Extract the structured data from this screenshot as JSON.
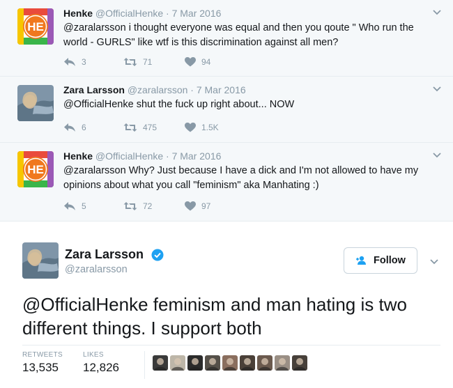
{
  "replies": [
    {
      "name": "Henke",
      "handle": "@OfficialHenke",
      "date": "· 7 Mar 2016",
      "text": "@zaralarsson i thought everyone was equal and then you qoute \" Who run the world - GURLS\" like wtf is this discrimination against all men?",
      "replies_count": "3",
      "retweets": "71",
      "likes": "94",
      "avatar_icon": "he-logo-icon"
    },
    {
      "name": "Zara Larsson",
      "handle": "@zaralarsson",
      "date": "· 7 Mar 2016",
      "text": "@OfficialHenke shut the fuck up right about... NOW",
      "replies_count": "6",
      "retweets": "475",
      "likes": "1.5K",
      "avatar_icon": "profile-photo-icon"
    },
    {
      "name": "Henke",
      "handle": "@OfficialHenke",
      "date": "· 7 Mar 2016",
      "text": "@zaralarsson Why? Just because I have a dick and I'm not allowed to have my opinions about what you call \"feminism\" aka Manhating :)",
      "replies_count": "5",
      "retweets": "72",
      "likes": "97",
      "avatar_icon": "he-logo-icon"
    }
  ],
  "main_tweet": {
    "name": "Zara Larsson",
    "handle": "@zaralarsson",
    "follow_label": "Follow",
    "text": "@OfficialHenke feminism and man hating is two different things. I support both",
    "retweets_label": "RETWEETS",
    "retweets_value": "13,535",
    "likes_label": "LIKES",
    "likes_value": "12,826",
    "liker_count": 9
  },
  "colors": {
    "reply_bg": "#f5f8fa",
    "muted": "#8899a6",
    "verified": "#1da1f2",
    "he_orange": "#f0781e"
  }
}
